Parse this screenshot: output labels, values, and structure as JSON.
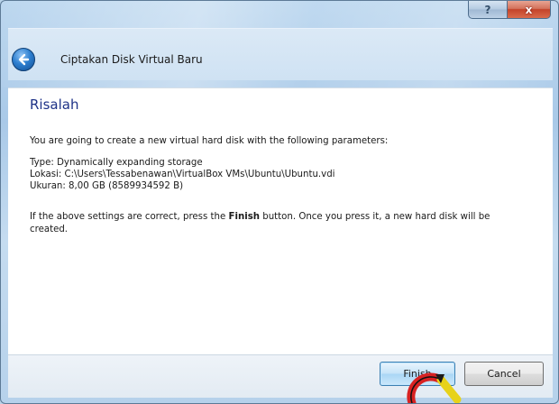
{
  "window": {
    "help_label": "?",
    "close_label": "x",
    "title": "Ciptakan Disk Virtual Baru"
  },
  "page": {
    "heading": "Risalah",
    "intro": "You are going to create a new virtual hard disk with the following parameters:",
    "params": [
      "Type:   Dynamically expanding storage",
      "Lokasi:  C:\\Users\\Tessabenawan\\VirtualBox VMs\\Ubuntu\\Ubuntu.vdi",
      "Ukuran: 8,00 GB (8589934592 B)"
    ],
    "note_before": "If the above settings are correct, press the ",
    "note_bold": "Finish",
    "note_after_line1": " button. Once you press it, a new hard disk will be",
    "note_line2": "created."
  },
  "buttons": {
    "finish": "Finish",
    "cancel": "Cancel"
  },
  "icons": {
    "back": "back-arrow-icon",
    "cursor": "busy-cursor-icon"
  },
  "colors": {
    "heading": "#1e3287",
    "window_frame": "#b9d3ea"
  }
}
